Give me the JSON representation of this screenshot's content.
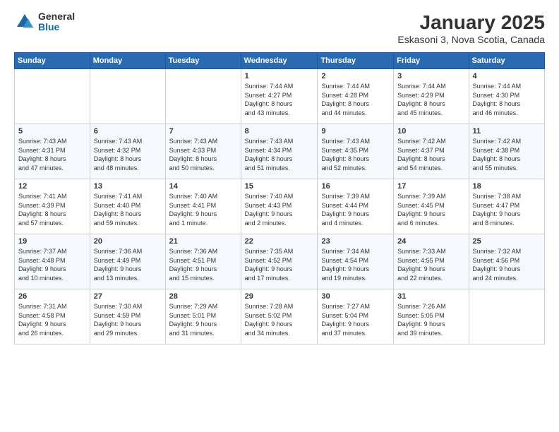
{
  "logo": {
    "general": "General",
    "blue": "Blue"
  },
  "title": "January 2025",
  "subtitle": "Eskasoni 3, Nova Scotia, Canada",
  "days_header": [
    "Sunday",
    "Monday",
    "Tuesday",
    "Wednesday",
    "Thursday",
    "Friday",
    "Saturday"
  ],
  "weeks": [
    [
      {
        "day": "",
        "info": ""
      },
      {
        "day": "",
        "info": ""
      },
      {
        "day": "",
        "info": ""
      },
      {
        "day": "1",
        "info": "Sunrise: 7:44 AM\nSunset: 4:27 PM\nDaylight: 8 hours\nand 43 minutes."
      },
      {
        "day": "2",
        "info": "Sunrise: 7:44 AM\nSunset: 4:28 PM\nDaylight: 8 hours\nand 44 minutes."
      },
      {
        "day": "3",
        "info": "Sunrise: 7:44 AM\nSunset: 4:29 PM\nDaylight: 8 hours\nand 45 minutes."
      },
      {
        "day": "4",
        "info": "Sunrise: 7:44 AM\nSunset: 4:30 PM\nDaylight: 8 hours\nand 46 minutes."
      }
    ],
    [
      {
        "day": "5",
        "info": "Sunrise: 7:43 AM\nSunset: 4:31 PM\nDaylight: 8 hours\nand 47 minutes."
      },
      {
        "day": "6",
        "info": "Sunrise: 7:43 AM\nSunset: 4:32 PM\nDaylight: 8 hours\nand 48 minutes."
      },
      {
        "day": "7",
        "info": "Sunrise: 7:43 AM\nSunset: 4:33 PM\nDaylight: 8 hours\nand 50 minutes."
      },
      {
        "day": "8",
        "info": "Sunrise: 7:43 AM\nSunset: 4:34 PM\nDaylight: 8 hours\nand 51 minutes."
      },
      {
        "day": "9",
        "info": "Sunrise: 7:43 AM\nSunset: 4:35 PM\nDaylight: 8 hours\nand 52 minutes."
      },
      {
        "day": "10",
        "info": "Sunrise: 7:42 AM\nSunset: 4:37 PM\nDaylight: 8 hours\nand 54 minutes."
      },
      {
        "day": "11",
        "info": "Sunrise: 7:42 AM\nSunset: 4:38 PM\nDaylight: 8 hours\nand 55 minutes."
      }
    ],
    [
      {
        "day": "12",
        "info": "Sunrise: 7:41 AM\nSunset: 4:39 PM\nDaylight: 8 hours\nand 57 minutes."
      },
      {
        "day": "13",
        "info": "Sunrise: 7:41 AM\nSunset: 4:40 PM\nDaylight: 8 hours\nand 59 minutes."
      },
      {
        "day": "14",
        "info": "Sunrise: 7:40 AM\nSunset: 4:41 PM\nDaylight: 9 hours\nand 1 minute."
      },
      {
        "day": "15",
        "info": "Sunrise: 7:40 AM\nSunset: 4:43 PM\nDaylight: 9 hours\nand 2 minutes."
      },
      {
        "day": "16",
        "info": "Sunrise: 7:39 AM\nSunset: 4:44 PM\nDaylight: 9 hours\nand 4 minutes."
      },
      {
        "day": "17",
        "info": "Sunrise: 7:39 AM\nSunset: 4:45 PM\nDaylight: 9 hours\nand 6 minutes."
      },
      {
        "day": "18",
        "info": "Sunrise: 7:38 AM\nSunset: 4:47 PM\nDaylight: 9 hours\nand 8 minutes."
      }
    ],
    [
      {
        "day": "19",
        "info": "Sunrise: 7:37 AM\nSunset: 4:48 PM\nDaylight: 9 hours\nand 10 minutes."
      },
      {
        "day": "20",
        "info": "Sunrise: 7:36 AM\nSunset: 4:49 PM\nDaylight: 9 hours\nand 13 minutes."
      },
      {
        "day": "21",
        "info": "Sunrise: 7:36 AM\nSunset: 4:51 PM\nDaylight: 9 hours\nand 15 minutes."
      },
      {
        "day": "22",
        "info": "Sunrise: 7:35 AM\nSunset: 4:52 PM\nDaylight: 9 hours\nand 17 minutes."
      },
      {
        "day": "23",
        "info": "Sunrise: 7:34 AM\nSunset: 4:54 PM\nDaylight: 9 hours\nand 19 minutes."
      },
      {
        "day": "24",
        "info": "Sunrise: 7:33 AM\nSunset: 4:55 PM\nDaylight: 9 hours\nand 22 minutes."
      },
      {
        "day": "25",
        "info": "Sunrise: 7:32 AM\nSunset: 4:56 PM\nDaylight: 9 hours\nand 24 minutes."
      }
    ],
    [
      {
        "day": "26",
        "info": "Sunrise: 7:31 AM\nSunset: 4:58 PM\nDaylight: 9 hours\nand 26 minutes."
      },
      {
        "day": "27",
        "info": "Sunrise: 7:30 AM\nSunset: 4:59 PM\nDaylight: 9 hours\nand 29 minutes."
      },
      {
        "day": "28",
        "info": "Sunrise: 7:29 AM\nSunset: 5:01 PM\nDaylight: 9 hours\nand 31 minutes."
      },
      {
        "day": "29",
        "info": "Sunrise: 7:28 AM\nSunset: 5:02 PM\nDaylight: 9 hours\nand 34 minutes."
      },
      {
        "day": "30",
        "info": "Sunrise: 7:27 AM\nSunset: 5:04 PM\nDaylight: 9 hours\nand 37 minutes."
      },
      {
        "day": "31",
        "info": "Sunrise: 7:26 AM\nSunset: 5:05 PM\nDaylight: 9 hours\nand 39 minutes."
      },
      {
        "day": "",
        "info": ""
      }
    ]
  ]
}
